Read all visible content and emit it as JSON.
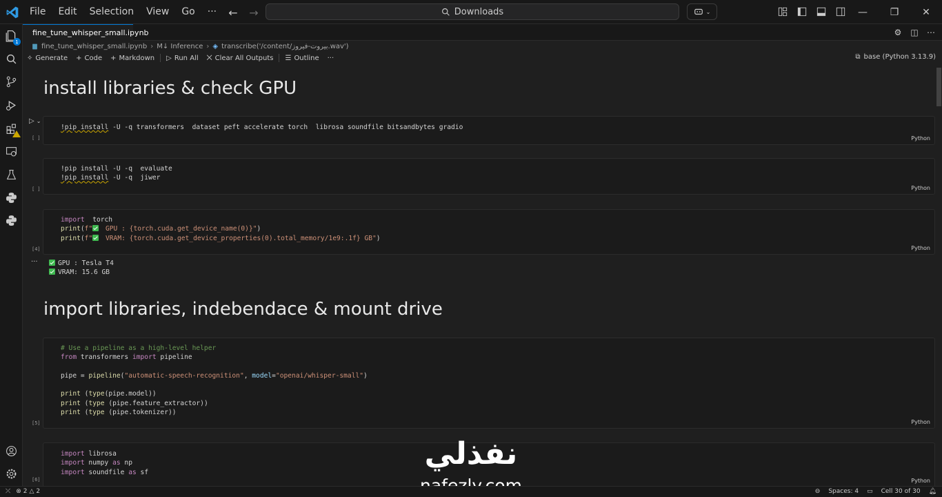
{
  "menu": [
    "File",
    "Edit",
    "Selection",
    "View",
    "Go",
    "···"
  ],
  "search": {
    "text": "Downloads"
  },
  "tab": {
    "label": "fine_tune_whisper_small.ipynb"
  },
  "breadcrumb": [
    "fine_tune_whisper_small.ipynb",
    "M↓ Inference",
    "transcribe('/content/بيروت-فيروز.wav')"
  ],
  "toolbar": {
    "generate": "Generate",
    "code": "Code",
    "markdown": "Markdown",
    "run_all": "Run All",
    "clear_outputs": "Clear All Outputs",
    "outline": "Outline",
    "more": "···",
    "kernel": "base (Python 3.13.9)"
  },
  "headings": {
    "h1": "install libraries & check GPU",
    "h2": "import libraries, indebendace & mount drive"
  },
  "cells": {
    "c1": {
      "count": "[ ]",
      "lang": "Python"
    },
    "c2": {
      "count": "[ ]",
      "lang": "Python"
    },
    "c3": {
      "count": "[4]",
      "lang": "Python",
      "out1": "GPU : Tesla T4",
      "out2": "VRAM: 15.6 GB"
    },
    "c4": {
      "count": "[5]",
      "lang": "Python"
    },
    "c5": {
      "count": "[6]",
      "lang": "Python"
    }
  },
  "watermark": {
    "arabic": "نفذلي",
    "latin": "nafezly.com"
  },
  "status": {
    "errors": "2",
    "warnings": "2",
    "spaces": "Spaces: 4",
    "cell": "Cell 30 of 30"
  },
  "colors": {
    "accent": "#0078d4",
    "background": "#1f1f1f",
    "warning": "#cca700"
  }
}
